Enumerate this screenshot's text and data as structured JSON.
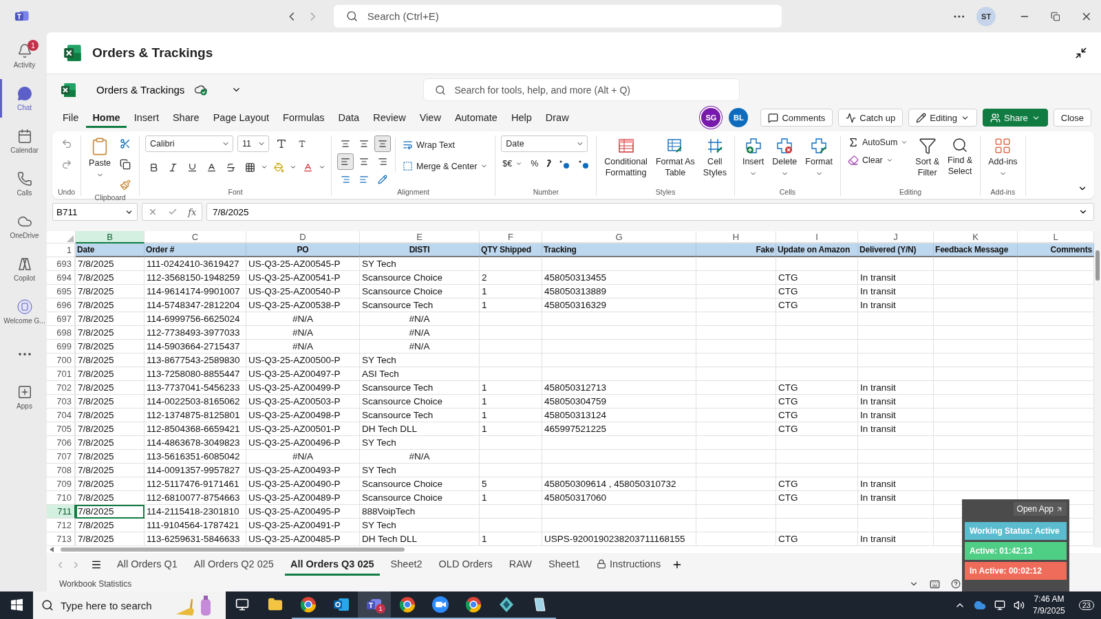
{
  "titlebar": {
    "search_placeholder": "Search (Ctrl+E)",
    "avatar": "ST"
  },
  "rail": [
    {
      "kind": "activity",
      "label": "Activity",
      "selected": false,
      "badge": "1"
    },
    {
      "kind": "chat",
      "label": "Chat",
      "selected": true
    },
    {
      "kind": "calendar",
      "label": "Calendar",
      "selected": false
    },
    {
      "kind": "calls",
      "label": "Calls",
      "selected": false
    },
    {
      "kind": "onedrive",
      "label": "OneDrive",
      "selected": false
    },
    {
      "kind": "copilot",
      "label": "Copilot",
      "selected": false
    },
    {
      "kind": "app",
      "label": "Welcome G...",
      "selected": false
    },
    {
      "kind": "more",
      "selected": false
    },
    {
      "kind": "apps",
      "label": "Apps",
      "selected": false
    }
  ],
  "page_title": "Orders & Trackings",
  "workbook": {
    "name": "Orders & Trackings",
    "search_placeholder": "Search for tools, help, and more (Alt + Q)"
  },
  "menu": [
    {
      "label": "File",
      "selected": false
    },
    {
      "label": "Home",
      "selected": true
    },
    {
      "label": "Insert",
      "selected": false
    },
    {
      "label": "Share",
      "selected": false
    },
    {
      "label": "Page Layout",
      "selected": false
    },
    {
      "label": "Formulas",
      "selected": false
    },
    {
      "label": "Data",
      "selected": false
    },
    {
      "label": "Review",
      "selected": false
    },
    {
      "label": "View",
      "selected": false
    },
    {
      "label": "Automate",
      "selected": false
    },
    {
      "label": "Help",
      "selected": false
    },
    {
      "label": "Draw",
      "selected": false
    }
  ],
  "collaborators": [
    {
      "initials": "SG",
      "color": "#7719aa"
    },
    {
      "initials": "BL",
      "color": "#0f6cbd"
    }
  ],
  "actions": [
    {
      "kind": "comments",
      "label": "Comments"
    },
    {
      "kind": "catchup",
      "label": "Catch up"
    },
    {
      "kind": "editing",
      "label": "Editing"
    },
    {
      "kind": "share",
      "label": "Share"
    },
    {
      "kind": "close",
      "label": "Close"
    }
  ],
  "ribbon": [
    {
      "kind": "undo",
      "label": "Undo"
    },
    {
      "kind": "clipboard",
      "label": "Clipboard",
      "paste": "Paste"
    },
    {
      "kind": "font",
      "label": "Font",
      "font": "Calibri",
      "size": "11"
    },
    {
      "kind": "alignment",
      "label": "Alignment",
      "wrap": "Wrap Text",
      "merge": "Merge & Center"
    },
    {
      "kind": "number",
      "label": "Number",
      "format": "Date",
      "currency": "$€",
      "percent": "%"
    },
    {
      "kind": "large",
      "label": "Styles",
      "buttons": [
        {
          "kind": "conditional",
          "lines": [
            "Conditional",
            "Formatting"
          ]
        },
        {
          "kind": "table",
          "lines": [
            "Format As",
            "Table"
          ]
        },
        {
          "kind": "cellstyles",
          "lines": [
            "Cell",
            "Styles"
          ]
        }
      ]
    },
    {
      "kind": "cells",
      "label": "Cells",
      "buttons": [
        {
          "kind": "insert",
          "lines": [
            "Insert"
          ]
        },
        {
          "kind": "delete",
          "lines": [
            "Delete"
          ]
        },
        {
          "kind": "format",
          "lines": [
            "Format"
          ]
        }
      ]
    },
    {
      "kind": "editing",
      "label": "Editing",
      "autosum": "AutoSum",
      "clear": "Clear",
      "buttons": [
        {
          "kind": "sort",
          "lines": [
            "Sort &",
            "Filter"
          ]
        },
        {
          "kind": "find",
          "lines": [
            "Find &",
            "Select"
          ]
        }
      ]
    },
    {
      "kind": "cells",
      "label": "Add-ins",
      "buttons": [
        {
          "kind": "addins",
          "lines": [
            "Add-ins"
          ]
        }
      ]
    }
  ],
  "formula_bar": {
    "name_box": "B711",
    "function_label": "fx",
    "formula": "7/8/2025"
  },
  "columns": [
    {
      "letter": "B",
      "selected": true
    },
    {
      "letter": "C",
      "selected": false
    },
    {
      "letter": "D",
      "selected": false
    },
    {
      "letter": "E",
      "selected": false
    },
    {
      "letter": "F",
      "selected": false
    },
    {
      "letter": "G",
      "selected": false
    },
    {
      "letter": "H",
      "selected": false
    },
    {
      "letter": "I",
      "selected": false
    },
    {
      "letter": "J",
      "selected": false
    },
    {
      "letter": "K",
      "selected": false
    },
    {
      "letter": "L",
      "selected": false
    }
  ],
  "header_row": {
    "number": "1",
    "cells": [
      "Date",
      "Order #",
      "PO",
      "DISTI",
      "QTY Shipped",
      "Tracking",
      "Fake",
      "Update on Amazon",
      "Delivered (Y/N)",
      "Feedback Message",
      "Comments"
    ]
  },
  "rows": [
    {
      "number": "693",
      "selected": false,
      "cells": [
        "7/8/2025",
        "111-0242410-3619427",
        "US-Q3-25-AZ00545-P",
        "SY Tech",
        null,
        null,
        null,
        null,
        null
      ]
    },
    {
      "number": "694",
      "selected": false,
      "cells": [
        "7/8/2025",
        "112-3568150-1948259",
        "US-Q3-25-AZ00541-P",
        "Scansource Choice",
        "2",
        "458050313455",
        null,
        "CTG",
        "In transit"
      ]
    },
    {
      "number": "695",
      "selected": false,
      "cells": [
        "7/8/2025",
        "114-9614174-9901007",
        "US-Q3-25-AZ00540-P",
        "Scansource Choice",
        "1",
        "458050313889",
        null,
        "CTG",
        "In transit"
      ]
    },
    {
      "number": "696",
      "selected": false,
      "cells": [
        "7/8/2025",
        "114-5748347-2812204",
        "US-Q3-25-AZ00538-P",
        "Scansource Tech",
        "1",
        "458050316329",
        null,
        "CTG",
        "In transit"
      ]
    },
    {
      "number": "697",
      "selected": false,
      "cells": [
        "7/8/2025",
        "114-6999756-6625024",
        {
          "text": "#N/A",
          "kind": "error"
        },
        {
          "text": "#N/A",
          "kind": "error"
        }
      ]
    },
    {
      "number": "698",
      "selected": false,
      "cells": [
        "7/8/2025",
        "112-7738493-3977033",
        {
          "text": "#N/A",
          "kind": "error"
        },
        {
          "text": "#N/A",
          "kind": "error"
        }
      ]
    },
    {
      "number": "699",
      "selected": false,
      "cells": [
        "7/8/2025",
        "114-5903664-2715437",
        {
          "text": "#N/A",
          "kind": "error"
        },
        {
          "text": "#N/A",
          "kind": "error"
        }
      ]
    },
    {
      "number": "700",
      "selected": false,
      "cells": [
        "7/8/2025",
        "113-8677543-2589830",
        "US-Q3-25-AZ00500-P",
        "SY Tech"
      ]
    },
    {
      "number": "701",
      "selected": false,
      "cells": [
        "7/8/2025",
        "113-7258080-8855447",
        "US-Q3-25-AZ00497-P",
        "ASI Tech"
      ]
    },
    {
      "number": "702",
      "selected": false,
      "cells": [
        "7/8/2025",
        "113-7737041-5456233",
        "US-Q3-25-AZ00499-P",
        "Scansource Tech",
        "1",
        "458050312713",
        null,
        "CTG",
        "In transit"
      ]
    },
    {
      "number": "703",
      "selected": false,
      "cells": [
        "7/8/2025",
        "114-0022503-8165062",
        "US-Q3-25-AZ00503-P",
        "Scansource Choice",
        "1",
        "458050304759",
        null,
        "CTG",
        "In transit"
      ]
    },
    {
      "number": "704",
      "selected": false,
      "cells": [
        "7/8/2025",
        "112-1374875-8125801",
        "US-Q3-25-AZ00498-P",
        "Scansource Tech",
        "1",
        "458050313124",
        null,
        "CTG",
        "In transit"
      ]
    },
    {
      "number": "705",
      "selected": false,
      "cells": [
        "7/8/2025",
        "112-8504368-6659421",
        "US-Q3-25-AZ00501-P",
        "DH Tech DLL",
        "1",
        "465997521225",
        null,
        "CTG",
        "In transit"
      ]
    },
    {
      "number": "706",
      "selected": false,
      "cells": [
        "7/8/2025",
        "114-4863678-3049823",
        "US-Q3-25-AZ00496-P",
        "SY Tech"
      ]
    },
    {
      "number": "707",
      "selected": false,
      "cells": [
        "7/8/2025",
        "113-5616351-6085042",
        {
          "text": "#N/A",
          "kind": "error"
        },
        {
          "text": "#N/A",
          "kind": "error"
        }
      ]
    },
    {
      "number": "708",
      "selected": false,
      "cells": [
        "7/8/2025",
        "114-0091357-9957827",
        "US-Q3-25-AZ00493-P",
        "SY Tech"
      ]
    },
    {
      "number": "709",
      "selected": false,
      "cells": [
        "7/8/2025",
        "112-5117476-9171461",
        "US-Q3-25-AZ00490-P",
        "Scansource Choice",
        "5",
        "458050309614 , 458050310732",
        null,
        "CTG",
        "In transit"
      ]
    },
    {
      "number": "710",
      "selected": false,
      "cells": [
        "7/8/2025",
        "112-6810077-8754663",
        "US-Q3-25-AZ00489-P",
        "Scansource Choice",
        "1",
        "458050317060",
        null,
        "CTG",
        "In transit"
      ]
    },
    {
      "number": "711",
      "selected": true,
      "cells": [
        "7/8/2025",
        "114-2115418-2301810",
        "US-Q3-25-AZ00495-P",
        "888VoipTech"
      ]
    },
    {
      "number": "712",
      "selected": false,
      "cells": [
        "7/8/2025",
        "111-9104564-1787421",
        "US-Q3-25-AZ00491-P",
        "SY Tech"
      ]
    },
    {
      "number": "713",
      "selected": false,
      "cells": [
        "7/8/2025",
        "113-6259631-5846633",
        "US-Q3-25-AZ00485-P",
        "DH Tech DLL",
        "1",
        "USPS-9200190238203711168155",
        null,
        "CTG",
        "In transit"
      ]
    }
  ],
  "sheets": [
    {
      "label": "All Orders Q1",
      "selected": false
    },
    {
      "label": "All Orders Q2 025",
      "selected": false
    },
    {
      "label": "All Orders Q3 025",
      "selected": true
    },
    {
      "label": "Sheet2",
      "selected": false
    },
    {
      "label": "OLD Orders",
      "selected": false
    },
    {
      "label": "RAW",
      "selected": false
    },
    {
      "label": "Sheet1",
      "selected": false
    },
    {
      "label": "Instructions",
      "selected": false,
      "locked": true
    }
  ],
  "status_bar": {
    "text": "Workbook Statistics"
  },
  "tracker": {
    "open_app": "Open App",
    "lines": [
      {
        "text": "Working Status: Active",
        "color": "#5bbccf"
      },
      {
        "text": "Active: 01:42:13",
        "color": "#4fce86"
      },
      {
        "text": "In Active: 00:02:12",
        "color": "#ef6b5a"
      }
    ]
  },
  "taskbar": {
    "search_placeholder": "Type here to search",
    "apps": [
      {
        "kind": "taskview",
        "running": false,
        "selected": false
      },
      {
        "kind": "folder",
        "running": false,
        "selected": false
      },
      {
        "kind": "browser",
        "running": true,
        "selected": false
      },
      {
        "kind": "mail",
        "running": true,
        "selected": false
      },
      {
        "kind": "teams",
        "running": true,
        "selected": true,
        "badge": "1"
      },
      {
        "kind": "browser",
        "running": true,
        "selected": false
      },
      {
        "kind": "zoom",
        "running": true,
        "selected": false
      },
      {
        "kind": "browser",
        "running": true,
        "selected": false
      },
      {
        "kind": "diamond",
        "running": true,
        "selected": false
      },
      {
        "kind": "glass",
        "running": true,
        "selected": false
      }
    ],
    "time": "7:46 AM",
    "date": "7/9/2025",
    "notifications": "23"
  }
}
